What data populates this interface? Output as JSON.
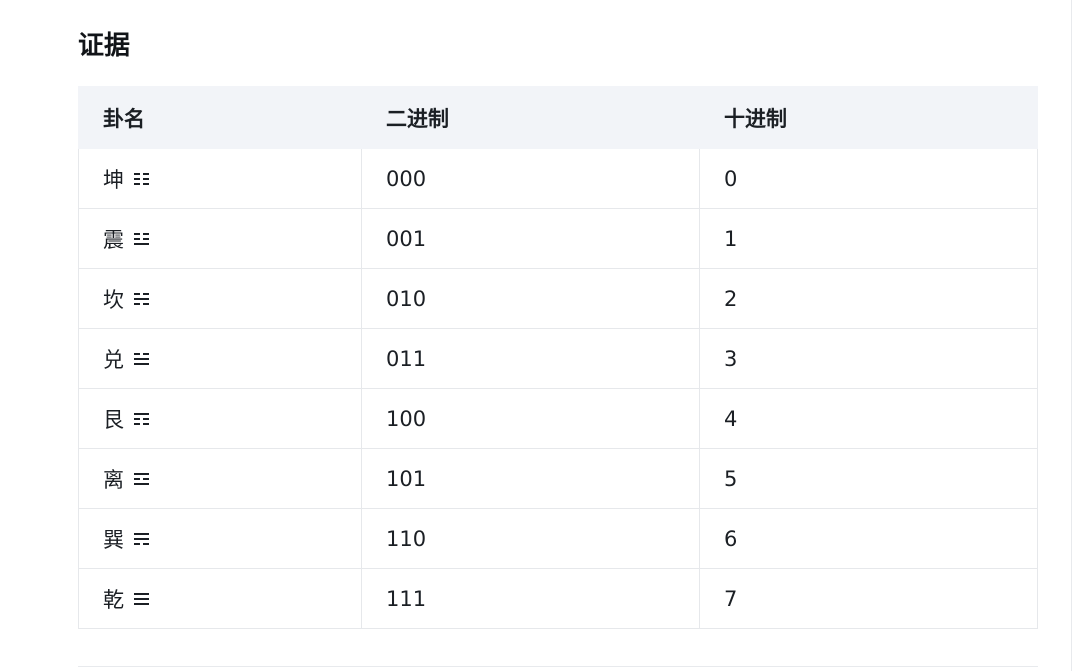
{
  "section_title": "证据",
  "table": {
    "headers": [
      "卦名",
      "二进制",
      "十进制"
    ],
    "rows": [
      {
        "name": "坤",
        "trigram": "000",
        "binary": "000",
        "decimal": "0"
      },
      {
        "name": "震",
        "trigram": "001",
        "binary": "001",
        "decimal": "1"
      },
      {
        "name": "坎",
        "trigram": "010",
        "binary": "010",
        "decimal": "2"
      },
      {
        "name": "兑",
        "trigram": "011",
        "binary": "011",
        "decimal": "3"
      },
      {
        "name": "艮",
        "trigram": "100",
        "binary": "100",
        "decimal": "4"
      },
      {
        "name": "离",
        "trigram": "101",
        "binary": "101",
        "decimal": "5"
      },
      {
        "name": "巽",
        "trigram": "110",
        "binary": "110",
        "decimal": "6"
      },
      {
        "name": "乾",
        "trigram": "111",
        "binary": "111",
        "decimal": "7"
      }
    ]
  }
}
